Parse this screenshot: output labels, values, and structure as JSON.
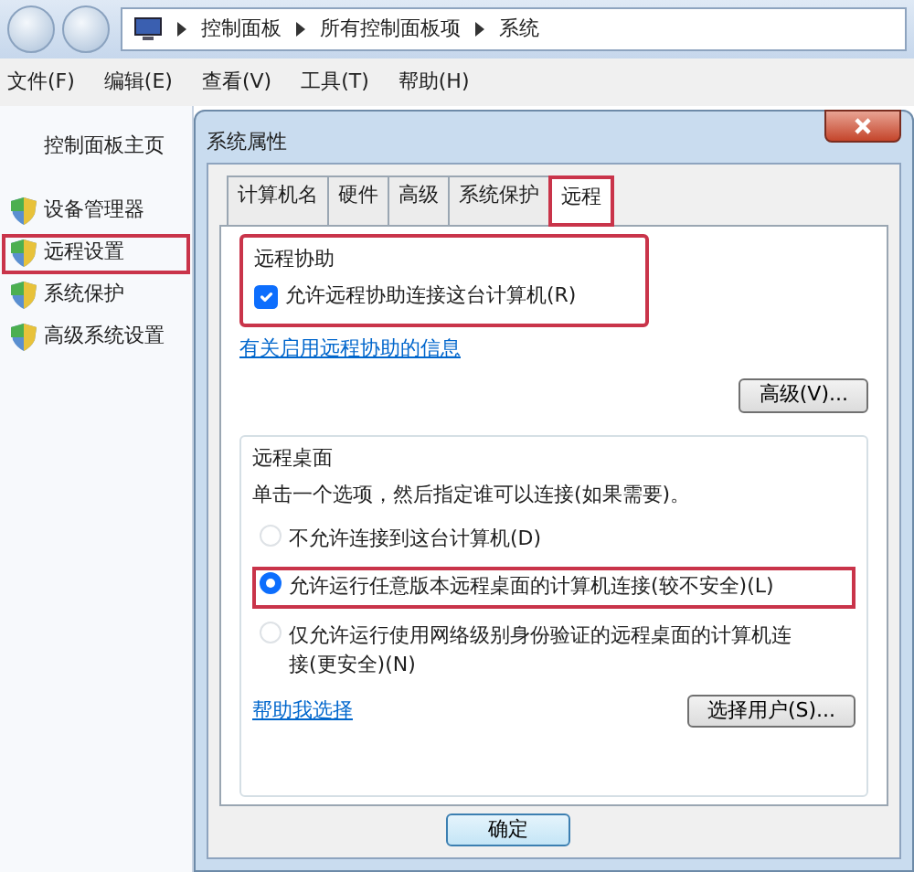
{
  "address_bar": {
    "crumbs": [
      "控制面板",
      "所有控制面板项",
      "系统"
    ]
  },
  "menu": [
    "文件(F)",
    "编辑(E)",
    "查看(V)",
    "工具(T)",
    "帮助(H)"
  ],
  "sidebar": {
    "title": "控制面板主页",
    "items": [
      {
        "label": "设备管理器",
        "highlighted": false
      },
      {
        "label": "远程设置",
        "highlighted": true
      },
      {
        "label": "系统保护",
        "highlighted": false
      },
      {
        "label": "高级系统设置",
        "highlighted": false
      }
    ]
  },
  "dialog": {
    "title": "系统属性",
    "tabs": [
      {
        "label": "计算机名",
        "selected": false,
        "highlighted": false
      },
      {
        "label": "硬件",
        "selected": false,
        "highlighted": false
      },
      {
        "label": "高级",
        "selected": false,
        "highlighted": false
      },
      {
        "label": "系统保护",
        "selected": false,
        "highlighted": false
      },
      {
        "label": "远程",
        "selected": true,
        "highlighted": true
      }
    ],
    "remote_assistance": {
      "title": "远程协助",
      "highlighted": true,
      "checkbox": {
        "label": "允许远程协助连接这台计算机(R)",
        "checked": true
      },
      "link": "有关启用远程协助的信息",
      "button": "高级(V)..."
    },
    "remote_desktop": {
      "title": "远程桌面",
      "hint": "单击一个选项，然后指定谁可以连接(如果需要)。",
      "options": [
        {
          "label": "不允许连接到这台计算机(D)",
          "selected": false,
          "highlighted": false
        },
        {
          "label": "允许运行任意版本远程桌面的计算机连接(较不安全)(L)",
          "selected": true,
          "highlighted": true
        },
        {
          "label": "仅允许运行使用网络级别身份验证的远程桌面的计算机连接(更安全)(N)",
          "selected": false,
          "highlighted": false
        }
      ],
      "link": "帮助我选择",
      "button": "选择用户(S)..."
    },
    "buttons": [
      "确定"
    ]
  }
}
